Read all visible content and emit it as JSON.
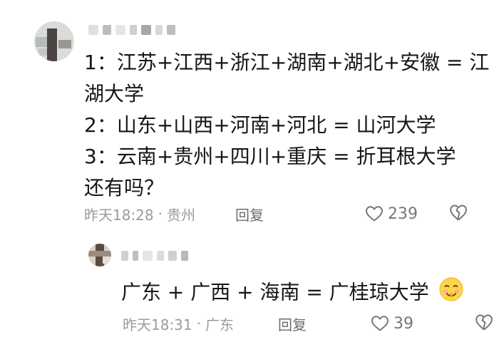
{
  "comment": {
    "lines": [
      "1：江苏+江西+浙江+湖南+湖北+安徽 = 江",
      "湖大学",
      "2：山东+山西+河南+河北 = 山河大学",
      "3：云南+贵州+四川+重庆 = 折耳根大学",
      "还有吗？"
    ],
    "time": "昨天18:28",
    "location": "贵州",
    "reply_label": "回复",
    "likes": "239"
  },
  "reply": {
    "text": "广东 + 广西 + 海南 = 广桂琼大学",
    "time": "昨天18:31",
    "location": "广东",
    "reply_label": "回复",
    "likes": "39"
  },
  "separator": "·",
  "icons": {
    "like": "heart-outline-icon",
    "dislike": "broken-heart-outline-icon",
    "emoji": "shush-face-emoji-icon"
  }
}
